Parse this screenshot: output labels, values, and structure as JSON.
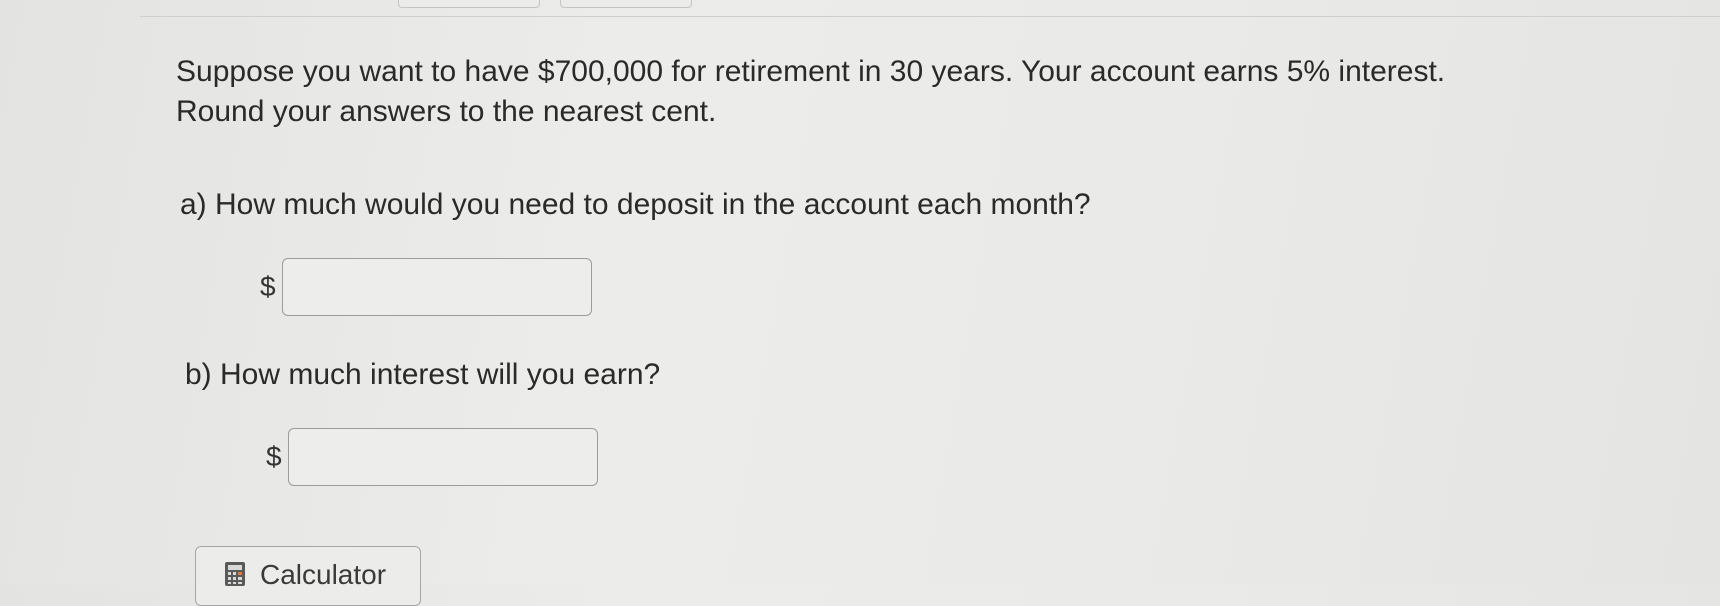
{
  "question": {
    "line1": "Suppose you want to have $700,000 for retirement in 30 years. Your account earns 5% interest.",
    "line2": "Round your answers to the nearest cent."
  },
  "part_a": {
    "label": "a) How much would you need to deposit in the account each month?",
    "currency_symbol": "$",
    "value": ""
  },
  "part_b": {
    "label": "b) How much interest will you earn?",
    "currency_symbol": "$",
    "value": ""
  },
  "calculator": {
    "label": "Calculator",
    "icon": "calculator-icon"
  }
}
